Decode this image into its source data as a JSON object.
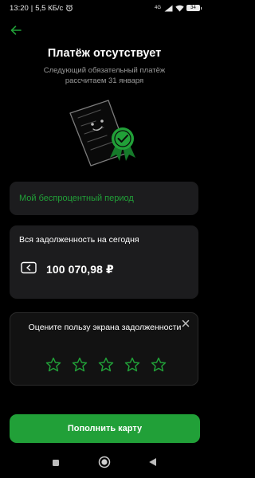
{
  "status_bar": {
    "time": "13:20",
    "speed": "5,5 КБ/с",
    "network": "4G",
    "battery": "34"
  },
  "header": {
    "title": "Платёж отсутствует",
    "subtitle": "Следующий обязательный платёж рассчитаем 31 января"
  },
  "period": {
    "label": "Мой беспроцентный период"
  },
  "debt": {
    "title": "Вся задолженность на сегодня",
    "amount": "100 070,98 ₽"
  },
  "rating": {
    "question": "Оцените пользу экрана задолженности",
    "stars_total": 5,
    "stars_selected": 0
  },
  "actions": {
    "topup_label": "Пополнить карту"
  },
  "colors": {
    "accent": "#21a038",
    "background": "#000000",
    "card": "#1c1c1e",
    "muted_text": "#9a9a9a"
  },
  "icons": [
    "back-arrow-icon",
    "document-badge-illustration",
    "card-icon",
    "close-icon",
    "star-icon",
    "nav-square-icon",
    "nav-circle-icon",
    "nav-back-icon"
  ]
}
